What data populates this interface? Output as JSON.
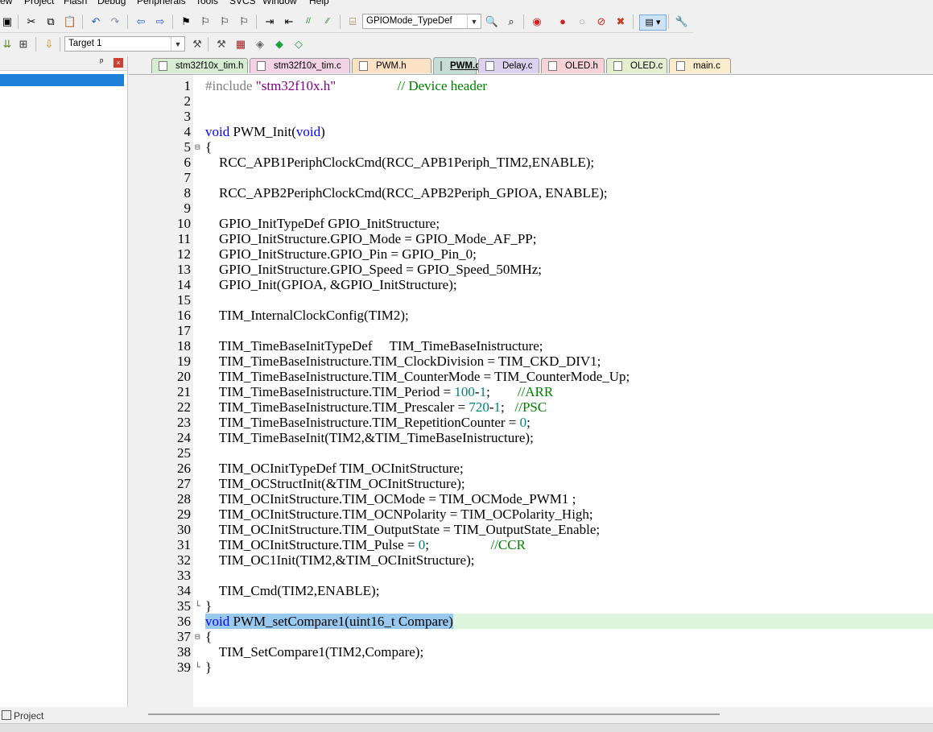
{
  "menu": [
    "ew",
    "Project",
    "Flash",
    "Debug",
    "Peripherals",
    "Tools",
    "SVCS",
    "Window",
    "Help"
  ],
  "toolbar1": {
    "buttons": [
      "save-all-icon",
      "cut-icon",
      "copy-icon",
      "paste-icon",
      "undo-icon",
      "redo-icon",
      "nav-back-icon",
      "nav-forward-icon",
      "bookmark-icon",
      "prev-bookmark-icon",
      "next-bookmark-icon",
      "clear-bookmarks-icon",
      "indent-icon",
      "unindent-icon",
      "comment-icon",
      "uncomment-icon"
    ],
    "find_combo_value": "GPIOMode_TypeDef",
    "buttons2": [
      "find-in-files-icon",
      "incremental-find-icon",
      "debug-session-icon",
      "breakpoint-icon",
      "disable-breakpoint-icon",
      "kill-breakpoints-icon",
      "kill-all-icon",
      "window-layout-icon",
      "configure-icon"
    ]
  },
  "toolbar2": {
    "buttons": [
      "build-icon",
      "rebuild-icon",
      "download-icon"
    ],
    "target_value": "Target 1",
    "buttons2": [
      "options-for-target-icon",
      "manage-project-items-icon",
      "select-packs-icon",
      "manage-runtime-icon",
      "pack-installer-icon"
    ]
  },
  "project_panel": {
    "pin": "ᵖ",
    "close": "×",
    "footer_tab": "Project"
  },
  "tabs": [
    {
      "label": "stm32f10x_tim.h",
      "color": "#d8ecd4",
      "active": false
    },
    {
      "label": "stm32f10x_tim.c",
      "color": "#f2d4e6",
      "active": false
    },
    {
      "label": "PWM.h",
      "color": "#fbe2c4",
      "active": false
    },
    {
      "label": "PWM.c",
      "color": "#c6ddd6",
      "active": true
    },
    {
      "label": "Delay.c",
      "color": "#dcd2f0",
      "active": false
    },
    {
      "label": "OLED.h",
      "color": "#f6d3d6",
      "active": false
    },
    {
      "label": "OLED.c",
      "color": "#e6eed0",
      "active": false
    },
    {
      "label": "main.c",
      "color": "#fbeccc",
      "active": false
    }
  ],
  "code": [
    [
      {
        "c": "pp",
        "t": "#include "
      },
      {
        "c": "str",
        "t": "\"stm32f10x.h\""
      },
      {
        "c": "",
        "t": "                  "
      },
      {
        "c": "cm",
        "t": "// Device header"
      }
    ],
    [],
    [],
    [
      {
        "c": "kw",
        "t": "void"
      },
      {
        "c": "",
        "t": " PWM_Init("
      },
      {
        "c": "kw",
        "t": "void"
      },
      {
        "c": "",
        "t": ")"
      }
    ],
    [
      {
        "c": "",
        "t": "{"
      }
    ],
    [
      {
        "c": "",
        "t": "    RCC_APB1PeriphClockCmd(RCC_APB1Periph_TIM2,ENABLE);"
      }
    ],
    [],
    [
      {
        "c": "",
        "t": "    RCC_APB2PeriphClockCmd(RCC_APB2Periph_GPIOA, ENABLE);"
      }
    ],
    [],
    [
      {
        "c": "",
        "t": "    GPIO_InitTypeDef GPIO_InitStructure;"
      }
    ],
    [
      {
        "c": "",
        "t": "    GPIO_InitStructure.GPIO_Mode = GPIO_Mode_AF_PP;"
      }
    ],
    [
      {
        "c": "",
        "t": "    GPIO_InitStructure.GPIO_Pin = GPIO_Pin_0;"
      }
    ],
    [
      {
        "c": "",
        "t": "    GPIO_InitStructure.GPIO_Speed = GPIO_Speed_50MHz;"
      }
    ],
    [
      {
        "c": "",
        "t": "    GPIO_Init(GPIOA, &GPIO_InitStructure);"
      }
    ],
    [],
    [
      {
        "c": "",
        "t": "    TIM_InternalClockConfig(TIM2);"
      }
    ],
    [],
    [
      {
        "c": "",
        "t": "    TIM_TimeBaseInitTypeDef     TIM_TimeBaseInistructure;"
      }
    ],
    [
      {
        "c": "",
        "t": "    TIM_TimeBaseInistructure.TIM_ClockDivision = TIM_CKD_DIV1;"
      }
    ],
    [
      {
        "c": "",
        "t": "    TIM_TimeBaseInistructure.TIM_CounterMode = TIM_CounterMode_Up;"
      }
    ],
    [
      {
        "c": "",
        "t": "    TIM_TimeBaseInistructure.TIM_Period = "
      },
      {
        "c": "num",
        "t": "100"
      },
      {
        "c": "",
        "t": "-"
      },
      {
        "c": "num",
        "t": "1"
      },
      {
        "c": "",
        "t": ";        "
      },
      {
        "c": "cm",
        "t": "//ARR"
      }
    ],
    [
      {
        "c": "",
        "t": "    TIM_TimeBaseInistructure.TIM_Prescaler = "
      },
      {
        "c": "num",
        "t": "720"
      },
      {
        "c": "",
        "t": "-"
      },
      {
        "c": "num",
        "t": "1"
      },
      {
        "c": "",
        "t": ";   "
      },
      {
        "c": "cm",
        "t": "//PSC"
      }
    ],
    [
      {
        "c": "",
        "t": "    TIM_TimeBaseInistructure.TIM_RepetitionCounter = "
      },
      {
        "c": "num",
        "t": "0"
      },
      {
        "c": "",
        "t": ";"
      }
    ],
    [
      {
        "c": "",
        "t": "    TIM_TimeBaseInit(TIM2,&TIM_TimeBaseInistructure);"
      }
    ],
    [],
    [
      {
        "c": "",
        "t": "    TIM_OCInitTypeDef TIM_OCInitStructure;"
      }
    ],
    [
      {
        "c": "",
        "t": "    TIM_OCStructInit(&TIM_OCInitStructure);"
      }
    ],
    [
      {
        "c": "",
        "t": "    TIM_OCInitStructure.TIM_OCMode = TIM_OCMode_PWM1 ;"
      }
    ],
    [
      {
        "c": "",
        "t": "    TIM_OCInitStructure.TIM_OCNPolarity = TIM_OCPolarity_High;"
      }
    ],
    [
      {
        "c": "",
        "t": "    TIM_OCInitStructure.TIM_OutputState = TIM_OutputState_Enable;"
      }
    ],
    [
      {
        "c": "",
        "t": "    TIM_OCInitStructure.TIM_Pulse = "
      },
      {
        "c": "num",
        "t": "0"
      },
      {
        "c": "",
        "t": ";                  "
      },
      {
        "c": "cm",
        "t": "//CCR"
      }
    ],
    [
      {
        "c": "",
        "t": "    TIM_OC1Init(TIM2,&TIM_OCInitStructure);"
      }
    ],
    [],
    [
      {
        "c": "",
        "t": "    TIM_Cmd(TIM2,ENABLE);"
      }
    ],
    [
      {
        "c": "",
        "t": "}"
      }
    ],
    [
      {
        "c": "kw sel",
        "t": "void"
      },
      {
        "c": "sel",
        "t": " PWM_setCompare1(uint16_t Compare)"
      }
    ],
    [
      {
        "c": "",
        "t": "{"
      }
    ],
    [
      {
        "c": "",
        "t": "    TIM_SetCompare1(TIM2,Compare);"
      }
    ],
    [
      {
        "c": "",
        "t": "}"
      }
    ]
  ],
  "fold_markers": {
    "5": "⊟",
    "35": "└",
    "37": "⊟",
    "39": "└"
  },
  "highlighted_line": 36
}
